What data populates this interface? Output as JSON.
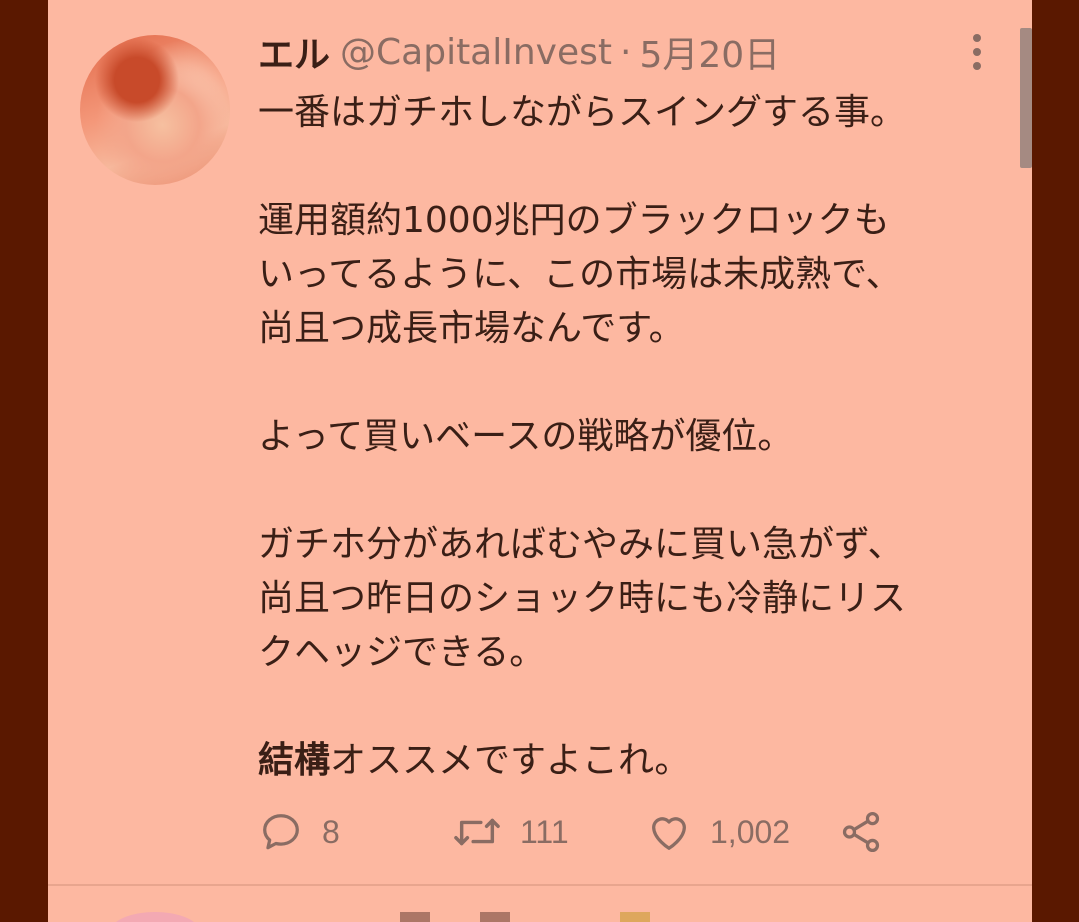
{
  "tweet": {
    "display_name": "エル",
    "handle": "@CapitalInvest",
    "separator": "·",
    "date": "5月20日",
    "paragraphs": [
      [
        "一番はガチホしながらスイングする事。"
      ],
      [
        "運用額約1000兆円のブラックロックも",
        "いってるように、この市場は未成熟で、",
        "尚且つ成長市場なんです。"
      ],
      [
        "よって買いベースの戦略が優位。"
      ],
      [
        "ガチホ分があればむやみに買い急がず、",
        "尚且つ昨日のショック時にも冷静にリス",
        "クヘッジできる。"
      ]
    ],
    "last_line_bold": "結構",
    "last_line_rest": "オススメですよこれ。",
    "reply_count": "8",
    "retweet_count": "111",
    "like_count": "1,002"
  },
  "icons": {
    "more": "more-vertical-icon",
    "reply": "reply-icon",
    "retweet": "retweet-icon",
    "like": "heart-icon",
    "share": "share-icon"
  },
  "colors": {
    "background": "#5a1800",
    "card": "#fdb8a1",
    "text": "#3a1f16",
    "secondary_text": "#8a6c63"
  }
}
